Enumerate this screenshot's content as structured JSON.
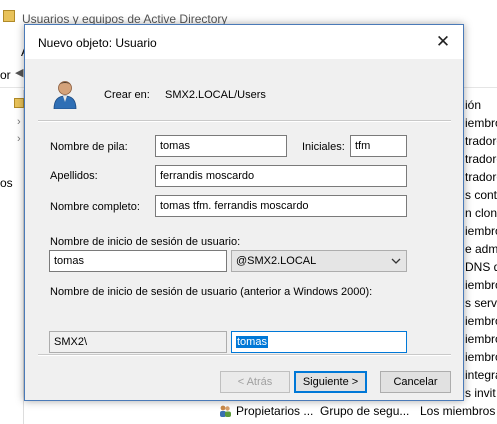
{
  "background_window": {
    "title": "Usuarios y equipos de Active Directory",
    "menu_first_letter": "A",
    "toolbar_fragment": "or",
    "tree_fragment": "os",
    "right_column_fragments": [
      "ión",
      "iembros",
      "tradore",
      "tradore",
      "tradore",
      "s cont",
      "n clon",
      "iembros",
      "e admi",
      "DNS q",
      "iembros",
      "s servi",
      "iembros",
      "iembros",
      "iembros",
      "integra",
      "s invit",
      "iembros"
    ],
    "bottom_row": {
      "name": "Propietarios ...",
      "type": "Grupo de segu...",
      "description": "Los miembros"
    }
  },
  "dialog": {
    "title": "Nuevo objeto: Usuario",
    "create_in_label": "Crear en:",
    "create_in_value": "SMX2.LOCAL/Users",
    "fields": {
      "first_name_label": "Nombre de pila:",
      "first_name_value": "tomas",
      "initials_label": "Iniciales:",
      "initials_value": "tfm",
      "last_name_label": "Apellidos:",
      "last_name_value": "ferrandis moscardo",
      "full_name_label": "Nombre completo:",
      "full_name_value": "tomas tfm. ferrandis moscardo",
      "logon_name_label": "Nombre de inicio de sesión de usuario:",
      "logon_name_value": "tomas",
      "domain_selected": "@SMX2.LOCAL",
      "pre2000_label": "Nombre de inicio de sesión de usuario (anterior a Windows 2000):",
      "pre2000_domain": "SMX2\\",
      "pre2000_value": "tomas"
    },
    "buttons": {
      "back": "< Atrás",
      "next": "Siguiente >",
      "cancel": "Cancelar"
    }
  }
}
